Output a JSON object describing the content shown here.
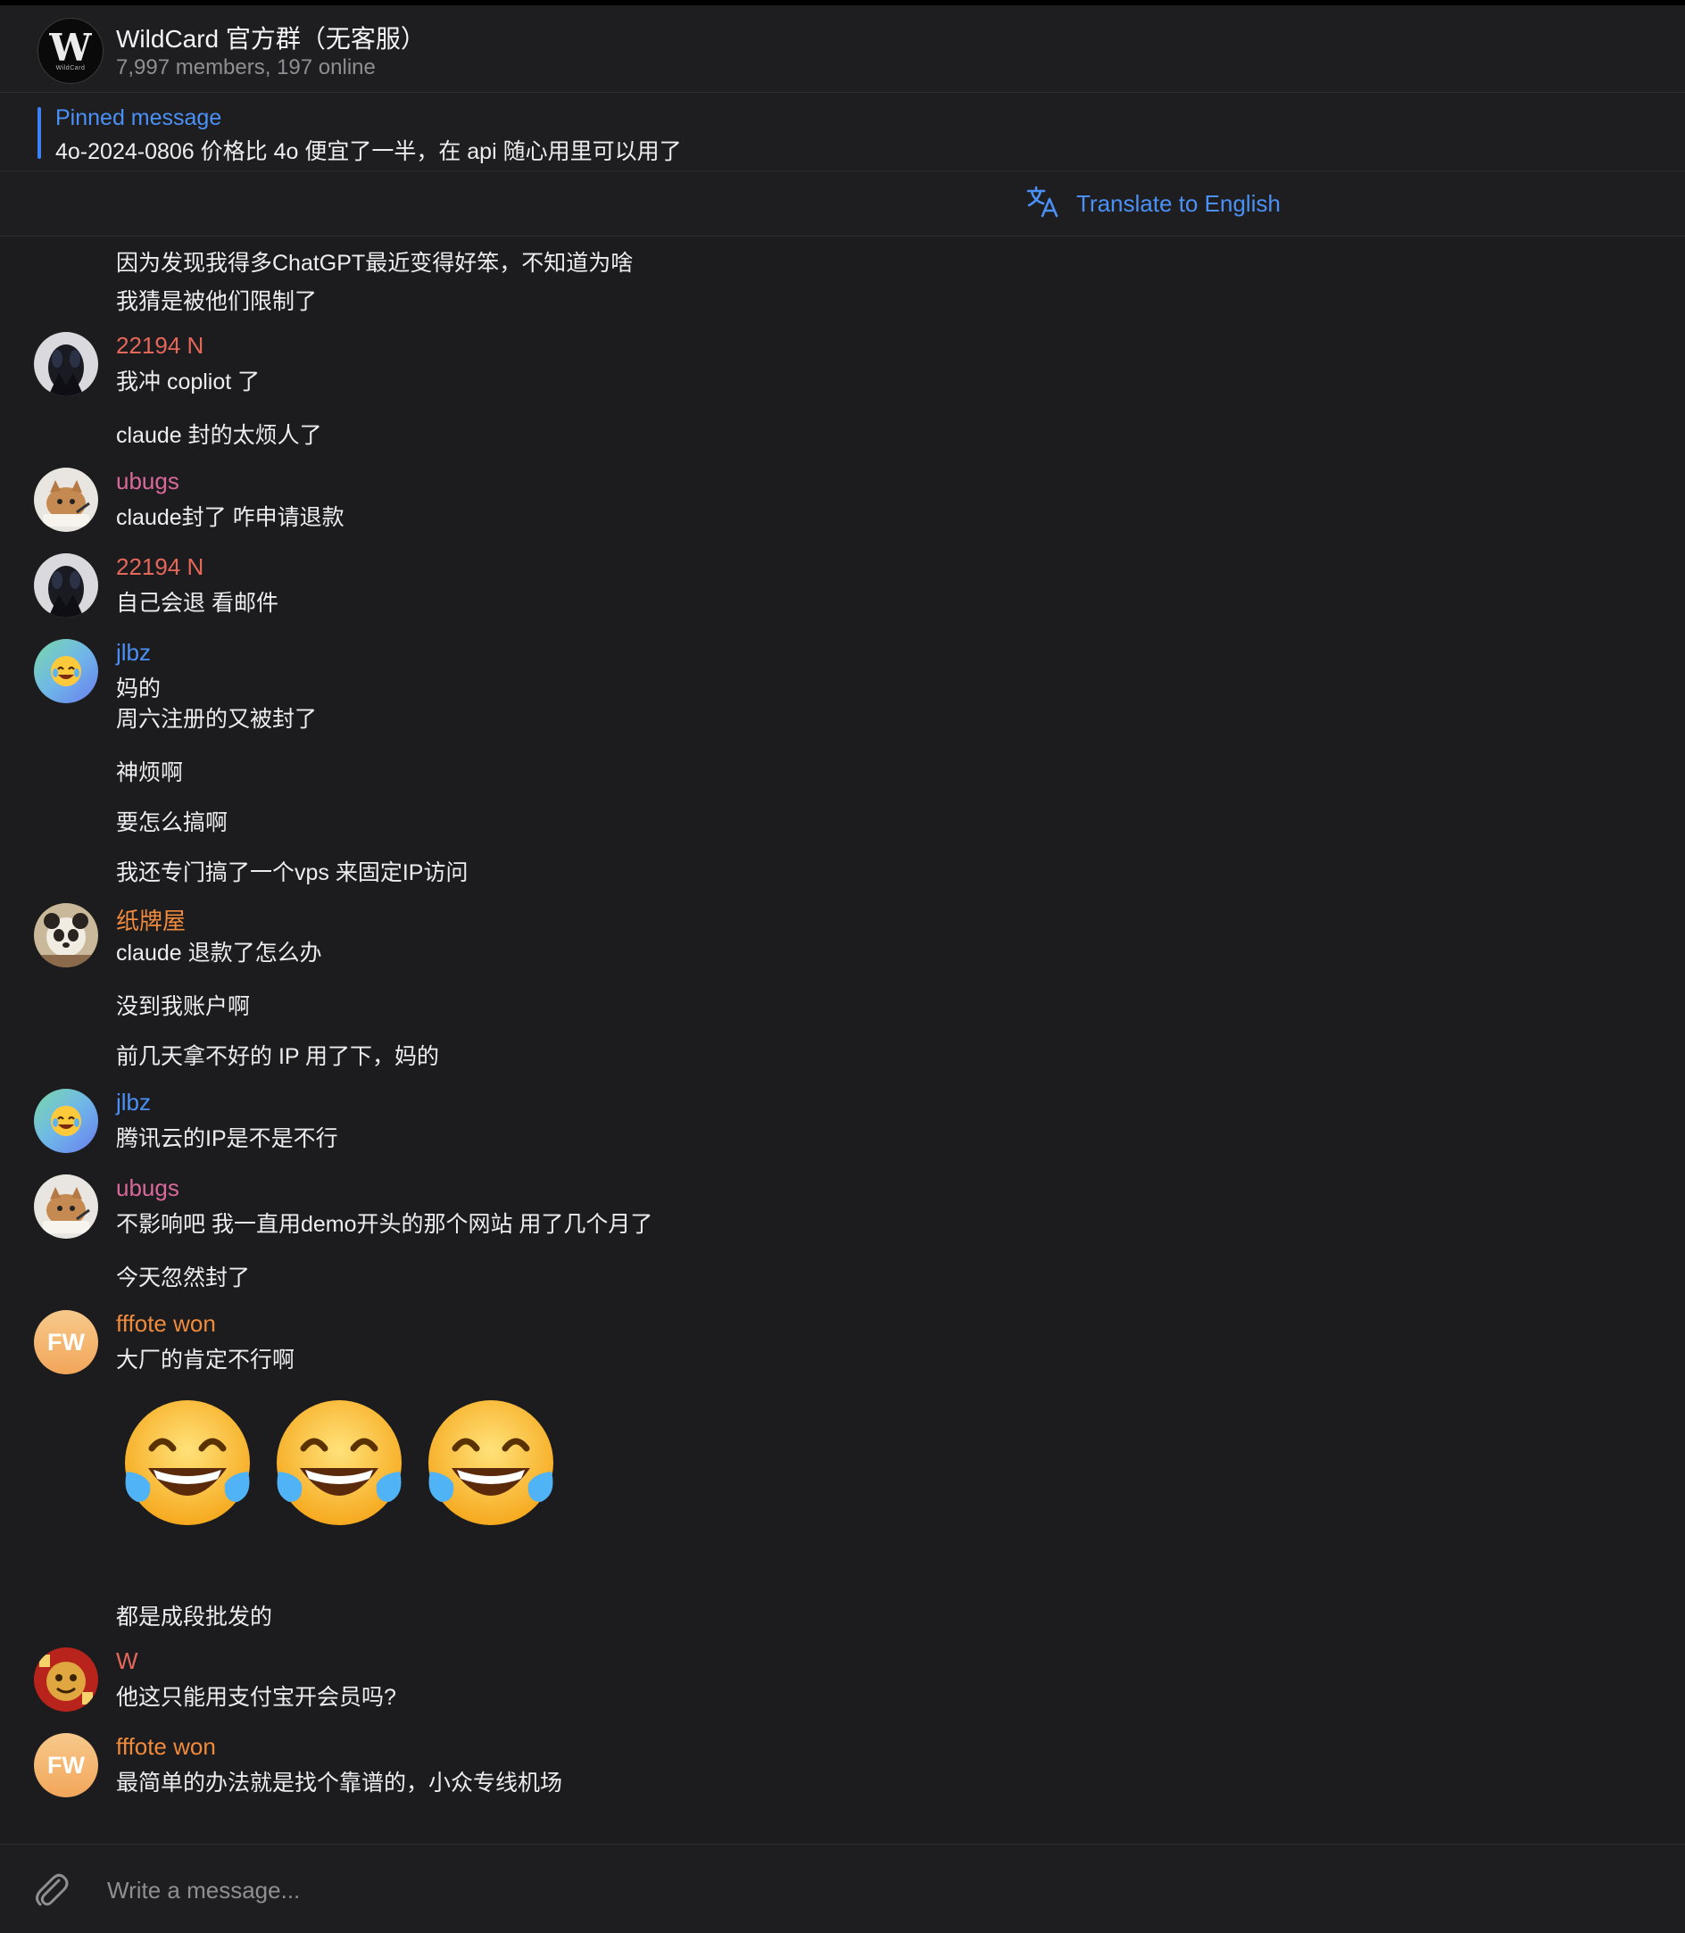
{
  "header": {
    "title": "WildCard 官方群（无客服）",
    "subtitle": "7,997 members, 197 online",
    "avatar_letter": "W",
    "avatar_sub": "WildCard"
  },
  "pinned": {
    "label": "Pinned message",
    "text": "4o-2024-0806 价格比 4o 便宜了一半，在 api 随心用里可以用了"
  },
  "translate": {
    "label": "Translate to English"
  },
  "messages": {
    "m0": "因为发现我得多ChatGPT最近变得好笨，不知道为啥",
    "m1": "我猜是被他们限制了",
    "s_22194a": "22194 N",
    "m2": "我冲 copliot 了",
    "m3": "claude 封的太烦人了",
    "s_ubugs_a": "ubugs",
    "m4": "claude封了 咋申请退款",
    "s_22194b": "22194 N",
    "m5": "自己会退 看邮件",
    "s_jlbz_a": "jlbz",
    "m6": "妈的",
    "m7": "周六注册的又被封了",
    "m8": "神烦啊",
    "m9": "要怎么搞啊",
    "m10": "我还专门搞了一个vps 来固定IP访问",
    "s_zpw": "纸牌屋",
    "m11": "claude 退款了怎么办",
    "m12": "没到我账户啊",
    "m13": "前几天拿不好的 IP 用了下，妈的",
    "s_jlbz_b": "jlbz",
    "m14": "腾讯云的IP是不是不行",
    "s_ubugs_b": "ubugs",
    "m15": "不影响吧 我一直用demo开头的那个网站 用了几个月了",
    "m16": "今天忽然封了",
    "s_fffote_a": "fffote won",
    "m17": "大厂的肯定不行啊",
    "m18": "都是成段批发的",
    "s_w": "W",
    "m19": "他这只能用支付宝开会员吗?",
    "s_fffote_b": "fffote won",
    "m20": "最简单的办法就是找个靠谱的，小众专线机场",
    "fw_initials": "FW"
  },
  "emoji": [
    "😂",
    "😂",
    "😂"
  ],
  "composer": {
    "placeholder": "Write a message..."
  },
  "colors": {
    "accent": "#4a90f5",
    "name_22194": "#e5675a",
    "name_ubugs": "#d9689b",
    "name_jlbz": "#4a90f5",
    "name_zpw": "#f08a3c",
    "name_fffote": "#f08a3c",
    "name_w": "#e5675a"
  },
  "icons": [
    "translate-icon",
    "paperclip-icon",
    "laughing-tears-emoji"
  ]
}
